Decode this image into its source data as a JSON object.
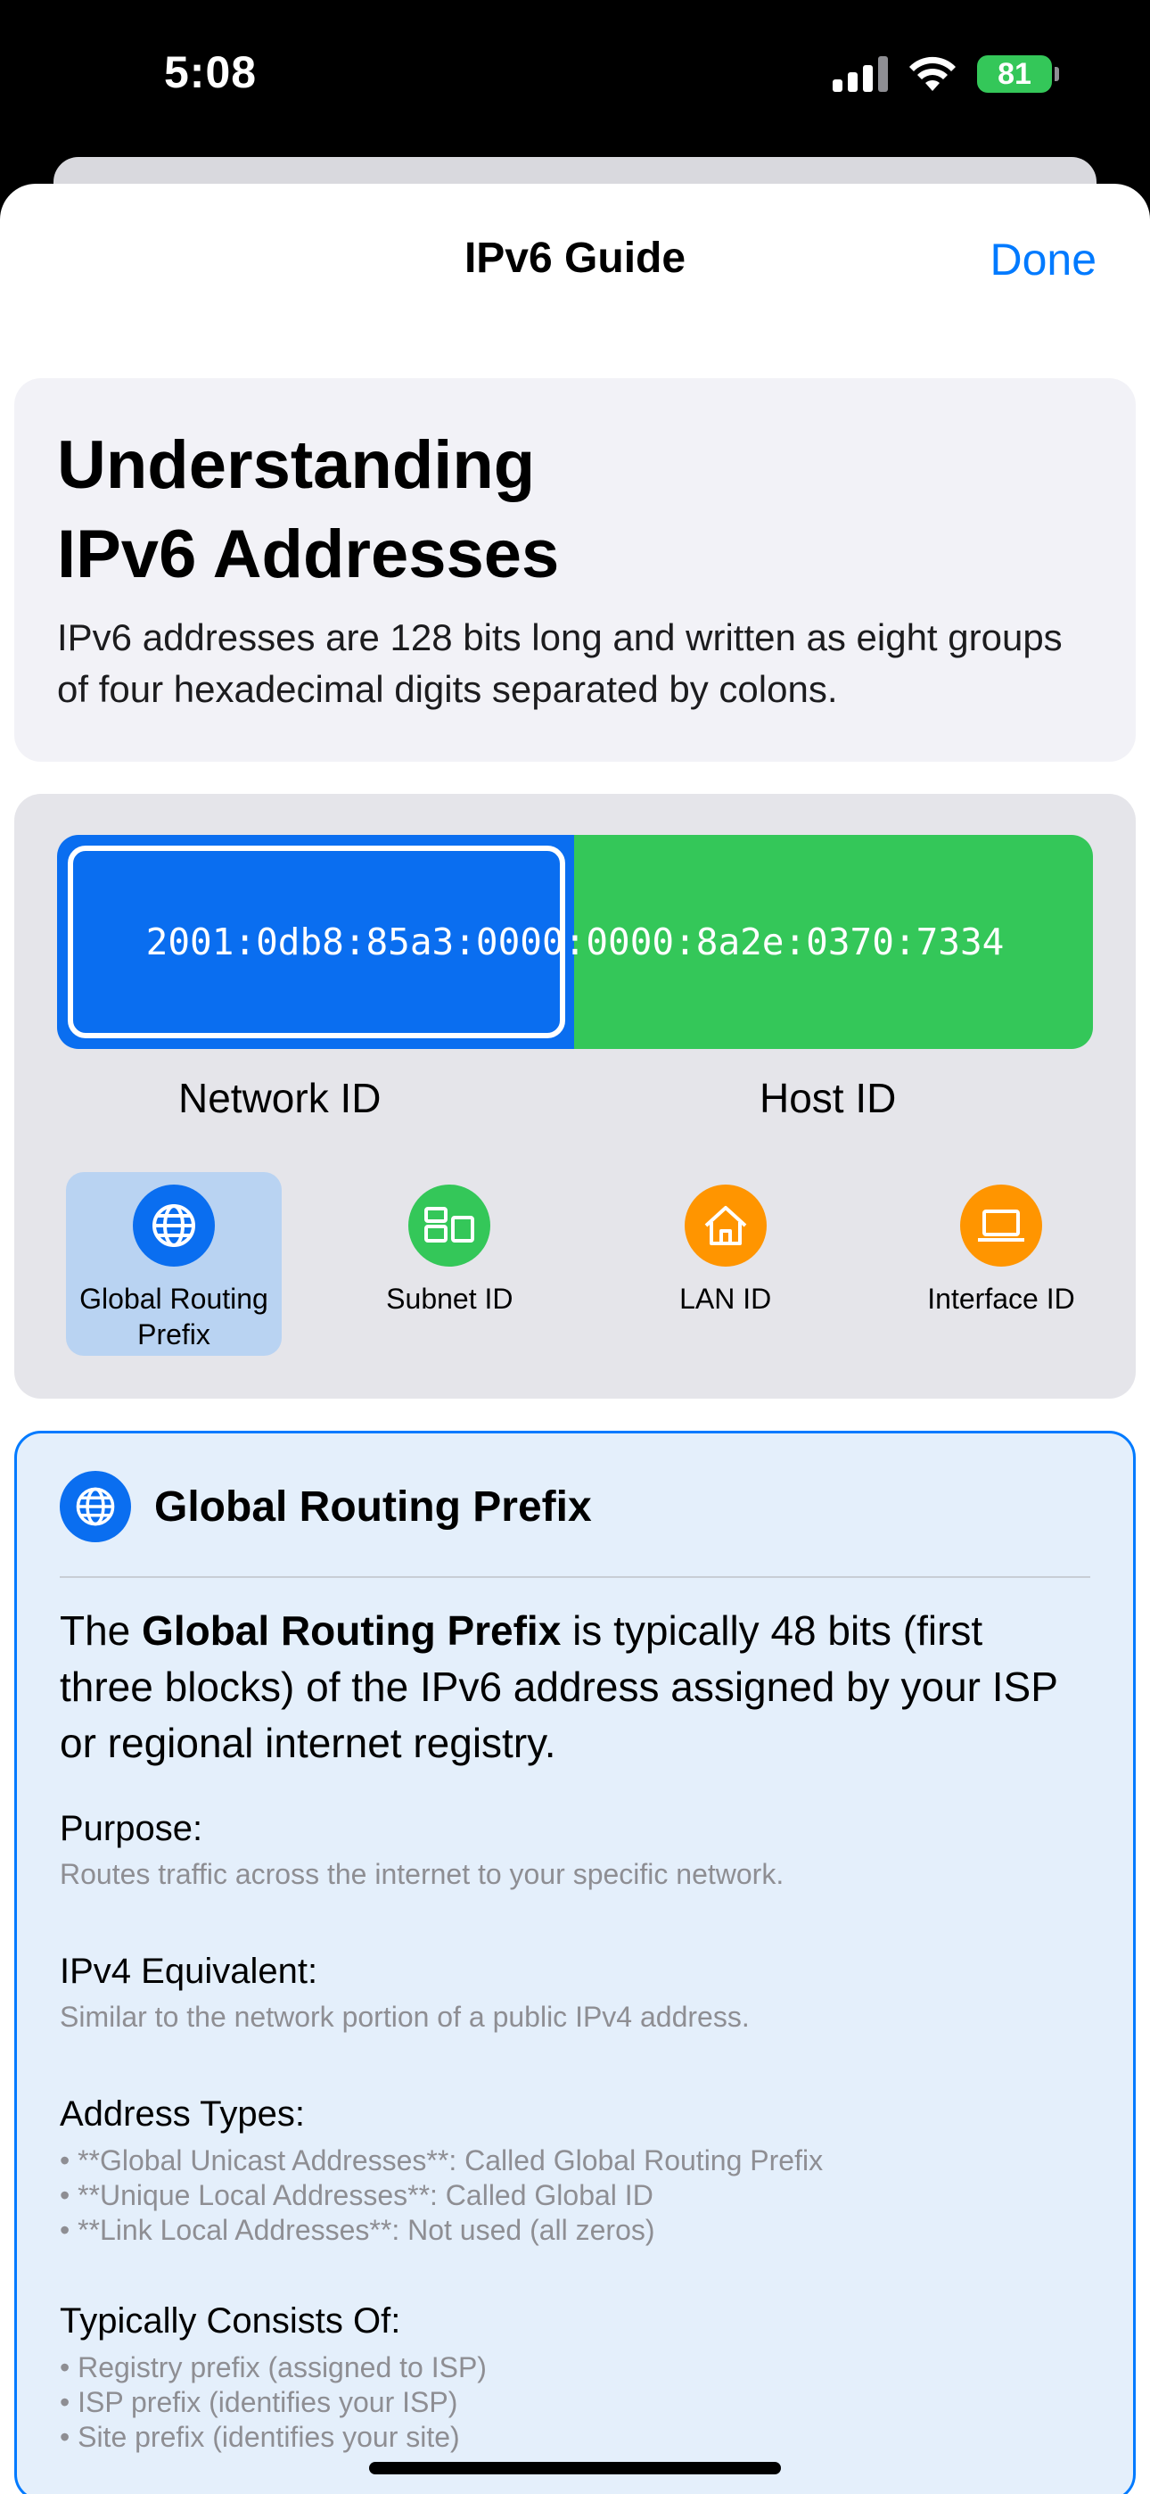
{
  "status_bar": {
    "time": "5:08",
    "battery": "81"
  },
  "nav": {
    "title": "IPv6 Guide",
    "done_label": "Done"
  },
  "intro": {
    "title_line1": "Understanding",
    "title_line2": "IPv6 Addresses",
    "description": "IPv6 addresses are 128 bits long and written as eight groups of four hexadecimal digits separated by colons."
  },
  "diagram": {
    "address": "2001:0db8:85a3:0000:0000:8a2e:0370:7334",
    "network_label": "Network ID",
    "host_label": "Host ID",
    "chips": [
      {
        "label": "Global Routing Prefix",
        "icon": "globe-icon",
        "color": "#0a6ef0",
        "selected": true
      },
      {
        "label": "Subnet ID",
        "icon": "subnet-icon",
        "color": "#34c759",
        "selected": false
      },
      {
        "label": "LAN ID",
        "icon": "house-icon",
        "color": "#ff9500",
        "selected": false
      },
      {
        "label": "Interface ID",
        "icon": "laptop-icon",
        "color": "#ff9500",
        "selected": false
      }
    ]
  },
  "detail": {
    "title": "Global Routing Prefix",
    "lead_prefix": "The ",
    "lead_bold": "Global Routing Prefix",
    "lead_suffix": " is typically 48 bits (first three blocks) of the IPv6 address assigned by your ISP or regional internet registry.",
    "purpose_heading": "Purpose:",
    "purpose_text": "Routes traffic across the internet to your specific network.",
    "ipv4_heading": "IPv4 Equivalent:",
    "ipv4_text": "Similar to the network portion of a public IPv4 address.",
    "types_heading": "Address Types:",
    "types": [
      "• **Global Unicast Addresses**: Called Global Routing Prefix",
      "• **Unique Local Addresses**: Called Global ID",
      "• **Link Local Addresses**: Not used (all zeros)"
    ],
    "consists_heading": "Typically Consists Of:",
    "consists": [
      "• Registry prefix (assigned to ISP)",
      "• ISP prefix (identifies your ISP)",
      "• Site prefix (identifies your site)"
    ]
  }
}
